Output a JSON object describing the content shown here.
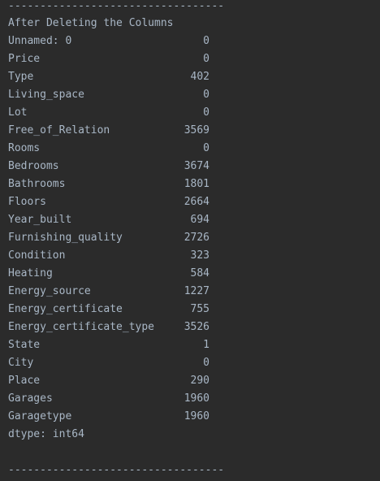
{
  "console": {
    "divider_top": "----------------------------------",
    "heading": "After Deleting the Columns",
    "rows": [
      {
        "key": "Unnamed: 0",
        "value": "0"
      },
      {
        "key": "Price",
        "value": "0"
      },
      {
        "key": "Type",
        "value": "402"
      },
      {
        "key": "Living_space",
        "value": "0"
      },
      {
        "key": "Lot",
        "value": "0"
      },
      {
        "key": "Free_of_Relation",
        "value": "3569"
      },
      {
        "key": "Rooms",
        "value": "0"
      },
      {
        "key": "Bedrooms",
        "value": "3674"
      },
      {
        "key": "Bathrooms",
        "value": "1801"
      },
      {
        "key": "Floors",
        "value": "2664"
      },
      {
        "key": "Year_built",
        "value": "694"
      },
      {
        "key": "Furnishing_quality",
        "value": "2726"
      },
      {
        "key": "Condition",
        "value": "323"
      },
      {
        "key": "Heating",
        "value": "584"
      },
      {
        "key": "Energy_source",
        "value": "1227"
      },
      {
        "key": "Energy_certificate",
        "value": "755"
      },
      {
        "key": "Energy_certificate_type",
        "value": "3526"
      },
      {
        "key": "State",
        "value": "1"
      },
      {
        "key": "City",
        "value": "0"
      },
      {
        "key": "Place",
        "value": "290"
      },
      {
        "key": "Garages",
        "value": "1960"
      },
      {
        "key": "Garagetype",
        "value": "1960"
      }
    ],
    "dtype": "dtype: int64",
    "divider_bottom": "----------------------------------"
  }
}
